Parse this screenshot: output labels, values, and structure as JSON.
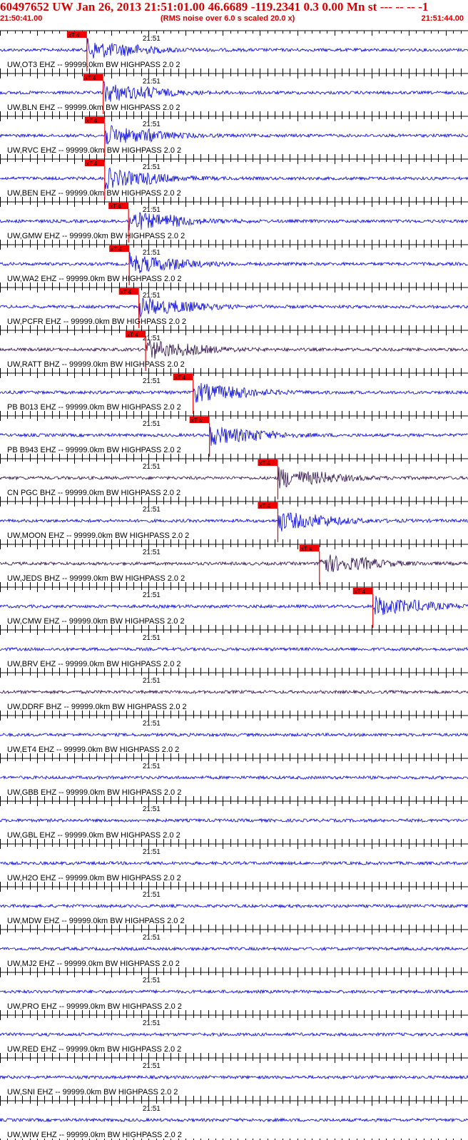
{
  "header": {
    "title": "60497652 UW Jan 26, 2013 21:51:01.00   46.6689 -119.2341  0.3 0.00 Mn st --- -- --  -1",
    "start_time": "21:50:41.00",
    "scale_note": "(RMS noise over 6.0 s scaled 20.0 x)",
    "end_time": "21:51:44.00"
  },
  "colors": {
    "title": "#d40000",
    "trace_blue": "#0000dd",
    "trace_dark": "#2a0a4a",
    "pick": "#ee0000",
    "grid": "#000000"
  },
  "chart_data": {
    "type": "line",
    "x_range_seconds": [
      0,
      63
    ],
    "minute_label": "21:51",
    "minute_offset_s": 19,
    "pick_label": "xT 4",
    "traces": [
      {
        "label": "UW,OT3 EHZ -- 99999.0km BW  HIGHPASS  2.0  2",
        "pick_s": 11.7,
        "style": "blue"
      },
      {
        "label": "UW,BLN EHZ -- 99999.0km BW  HIGHPASS  2.0  2",
        "pick_s": 13.9,
        "style": "blue"
      },
      {
        "label": "UW,RVC EHZ -- 99999.0km BW  HIGHPASS  2.0  2",
        "pick_s": 14.1,
        "style": "blue"
      },
      {
        "label": "UW,BEN EHZ -- 99999.0km BW  HIGHPASS  2.0  2",
        "pick_s": 14.1,
        "style": "blue"
      },
      {
        "label": "UW,GMW EHZ -- 99999.0km BW  HIGHPASS  2.0  2",
        "pick_s": 17.3,
        "style": "blue"
      },
      {
        "label": "UW,WA2 EHZ -- 99999.0km BW  HIGHPASS  2.0  2",
        "pick_s": 17.4,
        "style": "blue"
      },
      {
        "label": "UW,PCFR EHZ -- 99999.0km BW  HIGHPASS  2.0  2",
        "pick_s": 18.7,
        "style": "blue"
      },
      {
        "label": "UW,RATT BHZ -- 99999.0km BW  HIGHPASS  2.0  2",
        "pick_s": 19.6,
        "style": "dark"
      },
      {
        "label": "PB B013 EHZ -- 99999.0km BW  HIGHPASS  2.0  2",
        "pick_s": 26.0,
        "style": "blue"
      },
      {
        "label": "PB B943 EHZ -- 99999.0km BW  HIGHPASS  2.0  2",
        "pick_s": 28.2,
        "style": "blue"
      },
      {
        "label": "CN PGC BHZ -- 99999.0km BW  HIGHPASS  2.0  2",
        "pick_s": 37.4,
        "style": "dark"
      },
      {
        "label": "UW,MOON EHZ -- 99999.0km BW  HIGHPASS  2.0  2",
        "pick_s": 37.4,
        "style": "blue"
      },
      {
        "label": "UW,JEDS BHZ -- 99999.0km BW  HIGHPASS  2.0  2",
        "pick_s": 43.0,
        "style": "dark"
      },
      {
        "label": "UW,CMW EHZ -- 99999.0km BW  HIGHPASS  2.0  2",
        "pick_s": 50.2,
        "style": "blue"
      },
      {
        "label": "UW,BRV EHZ -- 99999.0km BW  HIGHPASS  2.0  2",
        "pick_s": null,
        "style": "blue"
      },
      {
        "label": "UW,DDRF BHZ -- 99999.0km BW  HIGHPASS  2.0  2",
        "pick_s": null,
        "style": "dark"
      },
      {
        "label": "UW,ET4 EHZ -- 99999.0km BW  HIGHPASS  2.0  2",
        "pick_s": null,
        "style": "blue"
      },
      {
        "label": "UW,GBB EHZ -- 99999.0km BW  HIGHPASS  2.0  2",
        "pick_s": null,
        "style": "blue"
      },
      {
        "label": "UW,GBL EHZ -- 99999.0km BW  HIGHPASS  2.0  2",
        "pick_s": null,
        "style": "blue"
      },
      {
        "label": "UW,H2O EHZ -- 99999.0km BW  HIGHPASS  2.0  2",
        "pick_s": null,
        "style": "blue"
      },
      {
        "label": "UW,MDW EHZ -- 99999.0km BW  HIGHPASS  2.0  2",
        "pick_s": null,
        "style": "blue"
      },
      {
        "label": "UW,MJ2 EHZ -- 99999.0km BW  HIGHPASS  2.0  2",
        "pick_s": null,
        "style": "blue"
      },
      {
        "label": "UW,PRO EHZ -- 99999.0km BW  HIGHPASS  2.0  2",
        "pick_s": null,
        "style": "blue"
      },
      {
        "label": "UW,RED EHZ -- 99999.0km BW  HIGHPASS  2.0  2",
        "pick_s": null,
        "style": "blue"
      },
      {
        "label": "UW,SNI EHZ -- 99999.0km BW  HIGHPASS  2.0  2",
        "pick_s": null,
        "style": "blue"
      },
      {
        "label": "UW,WIW EHZ -- 99999.0km BW  HIGHPASS  2.0  2",
        "pick_s": null,
        "style": "blue"
      }
    ]
  }
}
